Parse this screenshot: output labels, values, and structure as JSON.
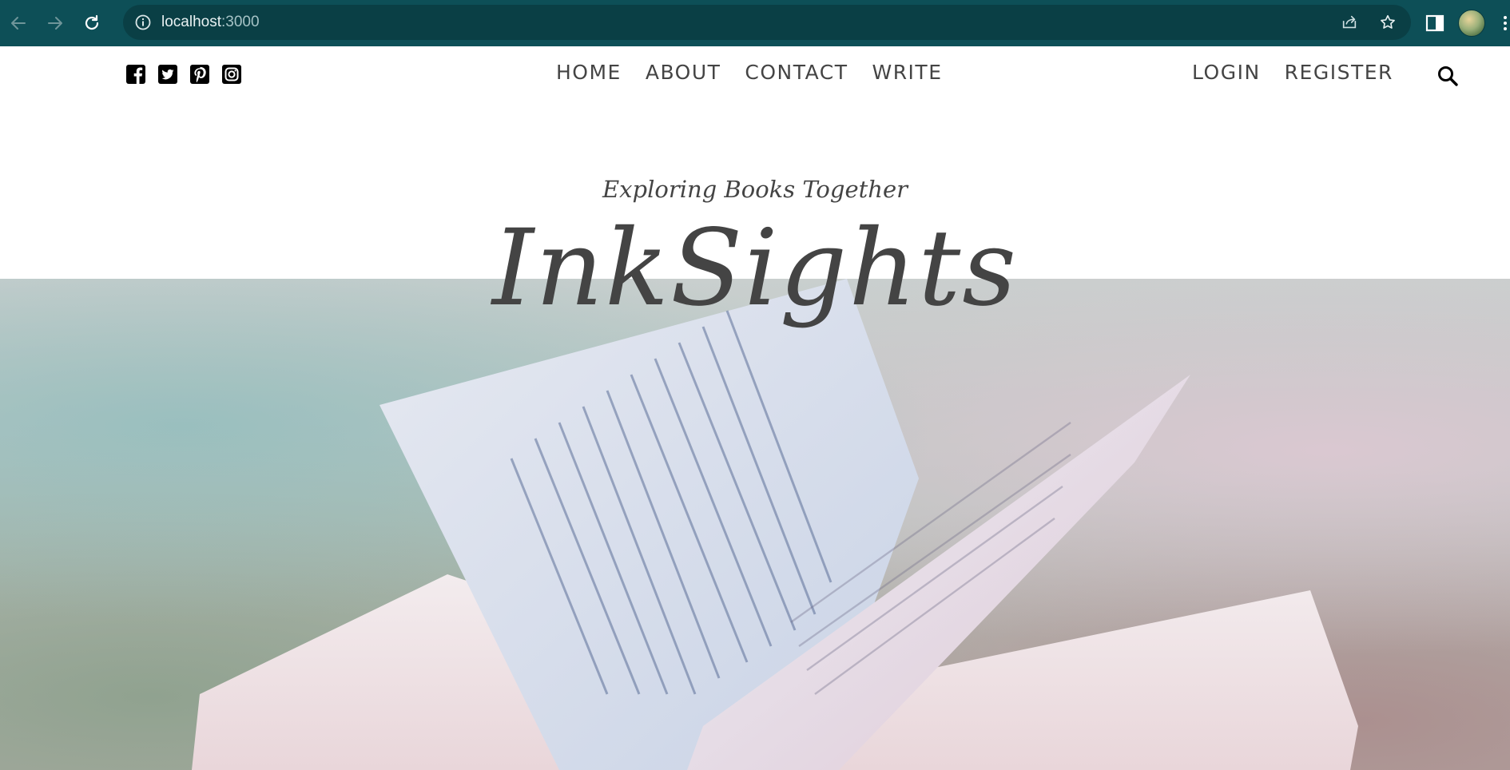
{
  "browser": {
    "url_host": "localhost",
    "url_port": ":3000"
  },
  "site": {
    "social": [
      {
        "icon": "facebook-square-icon"
      },
      {
        "icon": "twitter-square-icon"
      },
      {
        "icon": "pinterest-square-icon"
      },
      {
        "icon": "instagram-icon"
      }
    ],
    "menu": [
      "HOME",
      "ABOUT",
      "CONTACT",
      "WRITE"
    ],
    "auth": {
      "login": "LOGIN",
      "register": "REGISTER"
    },
    "tagline": "Exploring Books Together",
    "brand": "InkSights"
  },
  "colors": {
    "chrome_bg": "#0d4f57",
    "omnibox_bg": "#0a3f45",
    "text_dark": "#444444"
  }
}
